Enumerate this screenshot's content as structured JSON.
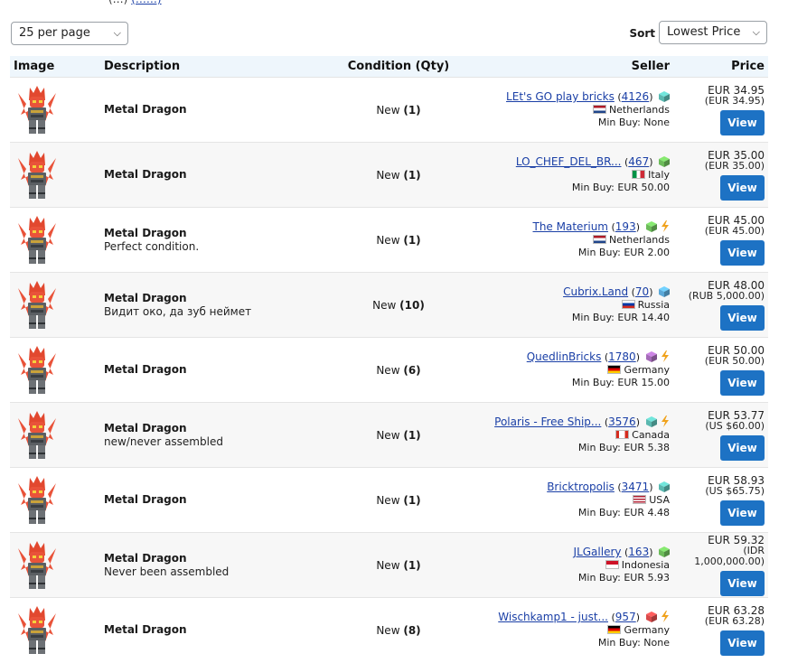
{
  "topline": {
    "text": "(…)",
    "link": "(……)"
  },
  "per_page": {
    "selected": "25 per page"
  },
  "sort": {
    "label": "Sort",
    "selected": "Lowest Price"
  },
  "columns": [
    "Image",
    "Description",
    "Condition (Qty)",
    "Seller",
    "Price"
  ],
  "listings": [
    {
      "title": "Metal Dragon",
      "note": "",
      "condition": "New",
      "qty": "(1)",
      "seller": "LEt's GO play bricks",
      "count": "4126",
      "box_color": "#5bb8b0",
      "bolt": false,
      "flag": "netherlands",
      "country": "Netherlands",
      "min_buy": "Min Buy: None",
      "price": "EUR 34.95",
      "orig": "(EUR 34.95)",
      "view": "View"
    },
    {
      "title": "Metal Dragon",
      "note": "",
      "condition": "New",
      "qty": "(1)",
      "seller": "LO_CHEF_DEL_BR...",
      "count": "467",
      "box_color": "#6cbb5a",
      "bolt": false,
      "flag": "italy",
      "country": "Italy",
      "min_buy": "Min Buy: EUR 50.00",
      "price": "EUR 35.00",
      "orig": "(EUR 35.00)",
      "view": "View"
    },
    {
      "title": "Metal Dragon",
      "note": "Perfect condition.",
      "condition": "New",
      "qty": "(1)",
      "seller": "The Materium",
      "count": "193",
      "box_color": "#6cbb5a",
      "bolt": true,
      "flag": "netherlands",
      "country": "Netherlands",
      "min_buy": "Min Buy: EUR 2.00",
      "price": "EUR 45.00",
      "orig": "(EUR 45.00)",
      "view": "View"
    },
    {
      "title": "Metal Dragon",
      "note": "Видит око, да зуб неймет",
      "condition": "New",
      "qty": "(10)",
      "seller": "Cubrix.Land",
      "count": "70",
      "box_color": "#5ba8d8",
      "bolt": false,
      "flag": "russia",
      "country": "Russia",
      "min_buy": "Min Buy: EUR 14.40",
      "price": "EUR 48.00",
      "orig": "(RUB 5,000.00)",
      "view": "View"
    },
    {
      "title": "Metal Dragon",
      "note": "",
      "condition": "New",
      "qty": "(6)",
      "seller": "QuedlinBricks",
      "count": "1780",
      "box_color": "#a46ab8",
      "bolt": true,
      "flag": "germany",
      "country": "Germany",
      "min_buy": "Min Buy: EUR 15.00",
      "price": "EUR 50.00",
      "orig": "(EUR 50.00)",
      "view": "View"
    },
    {
      "title": "Metal Dragon",
      "note": "new/never assembled",
      "condition": "New",
      "qty": "(1)",
      "seller": "Polaris - Free Ship...",
      "count": "3576",
      "box_color": "#5bb8b0",
      "bolt": true,
      "flag": "canada",
      "country": "Canada",
      "min_buy": "Min Buy: EUR 5.38",
      "price": "EUR 53.77",
      "orig": "(US $60.00)",
      "view": "View"
    },
    {
      "title": "Metal Dragon",
      "note": "",
      "condition": "New",
      "qty": "(1)",
      "seller": "Bricktropolis",
      "count": "3471",
      "box_color": "#5bb8b0",
      "bolt": false,
      "flag": "usa",
      "country": "USA",
      "min_buy": "Min Buy: EUR 4.48",
      "price": "EUR 58.93",
      "orig": "(US $65.75)",
      "view": "View"
    },
    {
      "title": "Metal Dragon",
      "note": "Never been assembled",
      "condition": "New",
      "qty": "(1)",
      "seller": "JLGallery",
      "count": "163",
      "box_color": "#6cbb5a",
      "bolt": false,
      "flag": "indonesia",
      "country": "Indonesia",
      "min_buy": "Min Buy: EUR 5.93",
      "price": "EUR 59.32",
      "orig": "(IDR 1,000,000.00)",
      "view": "View"
    },
    {
      "title": "Metal Dragon",
      "note": "",
      "condition": "New",
      "qty": "(8)",
      "seller": "Wischkamp1 - just...",
      "count": "957",
      "box_color": "#d84a4a",
      "bolt": true,
      "flag": "germany",
      "country": "Germany",
      "min_buy": "Min Buy: None",
      "price": "EUR 63.28",
      "orig": "(EUR 63.28)",
      "view": "View"
    }
  ]
}
